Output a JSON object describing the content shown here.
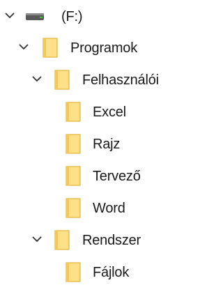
{
  "tree": {
    "drive": {
      "label": "(F:)",
      "icon": "drive-icon",
      "expanded": true
    },
    "programok": {
      "label": "Programok",
      "icon": "folder-icon",
      "expanded": true
    },
    "felhasznaloi": {
      "label": "Felhasználói",
      "icon": "folder-icon",
      "expanded": true
    },
    "excel": {
      "label": "Excel",
      "icon": "folder-icon"
    },
    "rajz": {
      "label": "Rajz",
      "icon": "folder-icon"
    },
    "tervezo": {
      "label": "Tervező",
      "icon": "folder-icon"
    },
    "word": {
      "label": "Word",
      "icon": "folder-icon"
    },
    "rendszer": {
      "label": "Rendszer",
      "icon": "folder-icon",
      "expanded": true
    },
    "fajlok": {
      "label": "Fájlok",
      "icon": "folder-icon"
    }
  },
  "colors": {
    "folder_fill": "#FFE08A",
    "folder_edge": "#E0B43C",
    "chevron": "#333333",
    "drive_body": "#5A5A5A",
    "drive_light": "#3CC43C"
  }
}
